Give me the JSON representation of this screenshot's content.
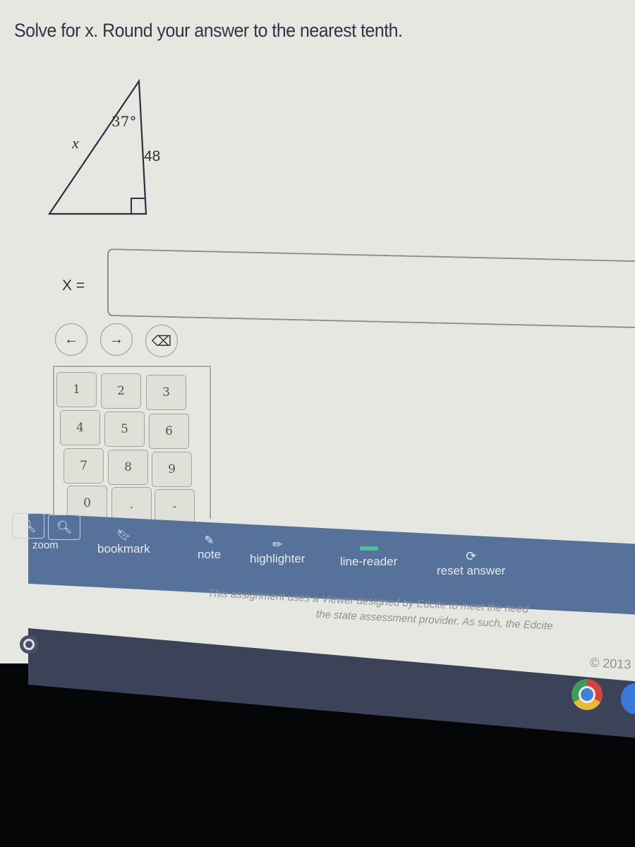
{
  "question": {
    "prompt": "Solve for x. Round your answer to the nearest tenth.",
    "figure": {
      "shape": "right-triangle",
      "hypotenuse_label": "x",
      "angle_label": "37°",
      "side_label": "48",
      "right_angle_marker": true
    }
  },
  "answer": {
    "label": "X =",
    "value": "",
    "placeholder": ""
  },
  "keypad": {
    "controls": [
      {
        "name": "cursor-left",
        "glyph": "←"
      },
      {
        "name": "cursor-right",
        "glyph": "→"
      },
      {
        "name": "backspace",
        "glyph": "⌫"
      }
    ],
    "keys": [
      "1",
      "2",
      "3",
      "4",
      "5",
      "6",
      "7",
      "8",
      "9",
      "0",
      ".",
      "-"
    ]
  },
  "toolbar": {
    "zoom_label": "zoom",
    "zoom_out_icon": "zoom-out-icon",
    "zoom_in_icon": "zoom-in-icon",
    "bookmark_label": "bookmark",
    "note_label": "note",
    "highlighter_label": "highlighter",
    "line_reader_label": "line-reader",
    "reset_label": "reset answer"
  },
  "footer": {
    "disclaimer_line1": "This assignment uses a Viewer designed by Edcite to meet the need",
    "disclaimer_line2": "the state assessment provider. As such, the Edcite",
    "copyright": "© 2013"
  },
  "colors": {
    "toolbar": "#56729a",
    "page_bg": "#e6e7e0",
    "shelf": "#3c4258"
  }
}
